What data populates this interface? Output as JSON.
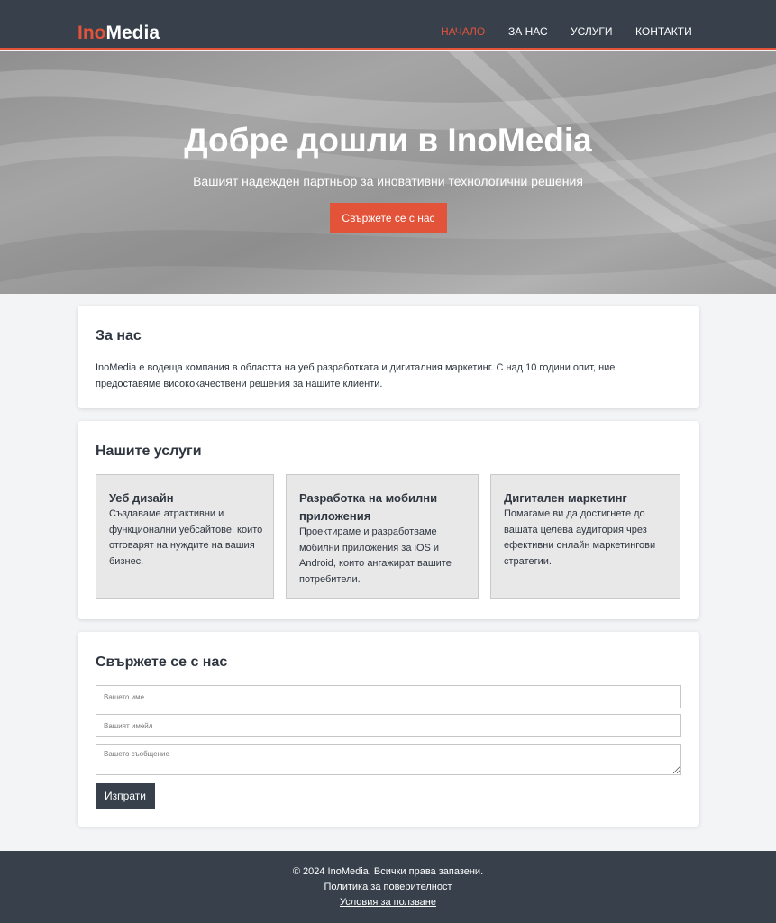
{
  "header": {
    "logo_accent": "Ino",
    "logo_rest": "Media",
    "nav": [
      "Начало",
      "За нас",
      "Услуги",
      "Контакти"
    ],
    "active_nav": "Начало"
  },
  "hero": {
    "title": "Добре дошли в InoMedia",
    "subtitle": "Вашият надежден партньор за иновативни технологични решения",
    "button": "Свържете се с нас"
  },
  "about": {
    "title": "За нас",
    "text": "InoMedia е водеща компания в областта на уеб разработката и дигиталния маркетинг. С над 10 години опит, ние предоставяме висококачествени решения за нашите клиенти."
  },
  "services": {
    "title": "Нашите услуги",
    "items": [
      {
        "title": "Уеб дизайн",
        "text": "Създаваме атрактивни и функционални уебсайтове, които отговарят на нуждите на вашия бизнес."
      },
      {
        "title": "Разработка на мобилни приложения",
        "text": "Проектираме и разработваме мобилни приложения за iOS и Android, които ангажират вашите потребители."
      },
      {
        "title": "Дигитален маркетинг",
        "text": "Помагаме ви да достигнете до вашата целева аудитория чрез ефективни онлайн маркетингови стратегии."
      }
    ]
  },
  "contact": {
    "title": "Свържете се с нас",
    "name_placeholder": "Вашето име",
    "email_placeholder": "Вашият имейл",
    "message_placeholder": "Вашето съобщение",
    "submit": "Изпрати"
  },
  "footer": {
    "copyright": "© 2024 InoMedia. Всички права запазени.",
    "privacy": "Политика за поверителност",
    "terms": "Условия за ползване"
  },
  "colors": {
    "accent": "#e2533a",
    "dark": "#37404b",
    "background": "#f3f4f6"
  }
}
